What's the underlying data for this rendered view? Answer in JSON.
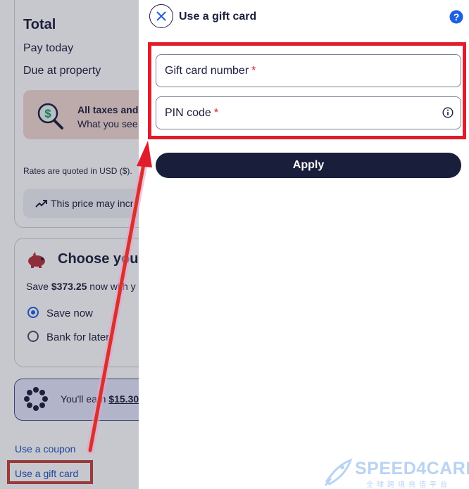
{
  "background": {
    "total_title": "Total",
    "pay_today": "Pay today",
    "due_at_property": "Due at property",
    "tax_line1": "All taxes and f",
    "tax_line2": "What you see",
    "rates_note": "Rates are quoted in USD ($).",
    "price_note": "This price may incr",
    "choose_title": "Choose your",
    "save_prefix": "Save ",
    "save_amount": "$373.25",
    "save_suffix": " now with y",
    "option_save_now": "Save now",
    "option_bank_later": "Bank for later",
    "earn_prefix": "You'll earn ",
    "earn_amount": "$15.30",
    "use_coupon": "Use a coupon",
    "use_gift_card": "Use a gift card"
  },
  "sheet": {
    "title": "Use a gift card",
    "fields": {
      "gift_card_number": {
        "label": "Gift card number",
        "required_mark": "*"
      },
      "pin_code": {
        "label": "PIN code",
        "required_mark": "*"
      }
    },
    "apply_label": "Apply"
  },
  "watermark": {
    "name": "SPEED4CARD",
    "subtitle": "全球跨境充值平台"
  },
  "colors": {
    "brand_navy": "#191e3b",
    "highlight_red": "#e01d2a",
    "link_blue": "#2050b8",
    "help_blue": "#1f5fe0",
    "arrow_red": "#d6322c"
  },
  "icons": {
    "close": "close-icon",
    "help": "help-circle-icon",
    "info": "info-icon",
    "taxes": "magnifier-dollar-icon",
    "trend": "trend-up-icon",
    "piggy": "piggy-bank-icon",
    "rewards": "rewards-dots-icon"
  }
}
